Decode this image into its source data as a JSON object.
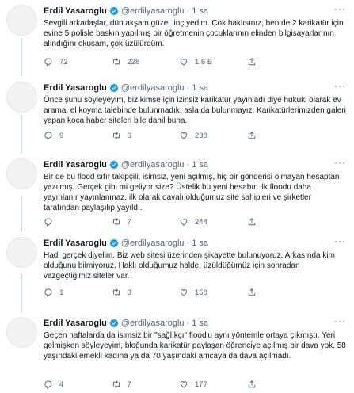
{
  "tweets": [
    {
      "name": "Erdil Yasaroglu",
      "handle": "@erdilyasaroglu",
      "time": "1 sa",
      "text": "Sevgili arkadaşlar, dün akşam güzel linç yedim. Çok haklısınız, ben de 2 karikatür için evine 5 polisle baskın yapılmış bir öğretmenin çocuklarının elinden bilgisayarlarının alındığını okusam, çok üzülürdüm.",
      "replies": "72",
      "retweets": "228",
      "likes": "1,6 B"
    },
    {
      "name": "Erdil Yasaroglu",
      "handle": "@erdilyasaroglu",
      "time": "1 sa",
      "text": "Önce şunu söyleyeyim, biz kimse için izinsiz karikatür yayınladı diye hukuki olarak ev arama, el koyma talebinde bulunmadık, asla da bulunmayız. Karikatürlerimizden galeri yapan koca haber siteleri bile dahil buna.",
      "replies": "9",
      "retweets": "6",
      "likes": "238"
    },
    {
      "name": "Erdil Yasaroglu",
      "handle": "@erdilyasaroglu",
      "time": "1 sa",
      "text": "Bir de bu flood sıfır takipçili, isimsiz, yeni açılmış, hiç bir gönderisi olmayan hesaptan yazılmış. Gerçek gibi mi geliyor size? Üstelik bu yeni hesabın ilk floodu daha yayınlanır yayınlanmaz, ilk olarak davalı olduğumuz site sahipleri ve şirketler tarafından paylaşılıp yayıldı.",
      "replies": "",
      "retweets": "7",
      "likes": "244"
    },
    {
      "name": "Erdil Yasaroglu",
      "handle": "@erdilyasaroglu",
      "time": "1 sa",
      "text": "Hadi gerçek diyelim. Biz web sitesi üzerinden şikayette bulunuyoruz. Arkasında kim olduğunu bilmiyoruz. Haklı olduğumuz halde, üzüldüğümüz için sonradan vazgeçtiğimiz siteler var.",
      "replies": "1",
      "retweets": "3",
      "likes": "158"
    },
    {
      "name": "Erdil Yasaroglu",
      "handle": "@erdilyasaroglu",
      "time": "1 sa",
      "text": "Geçen haftalarda da isimsiz bir \"sağlıkçı\" flood'u aynı yöntemle ortaya çıkmıştı. Yeri gelmişken söyleyeyim, bloğunda karikatür paylaşan öğrenciye açılmış bir dava yok. 58 yaşındaki emekli kadına ya da 70 yaşındaki amcaya da dava açılmadı.",
      "replies": "4",
      "retweets": "7",
      "likes": "177"
    }
  ],
  "colors": {
    "verified": "#1d9bf0",
    "icon": "#536471",
    "thread_line": "#cfd9de"
  },
  "icons": [
    "reply-icon",
    "retweet-icon",
    "like-icon",
    "share-icon",
    "verified-badge-icon",
    "more-icon"
  ]
}
